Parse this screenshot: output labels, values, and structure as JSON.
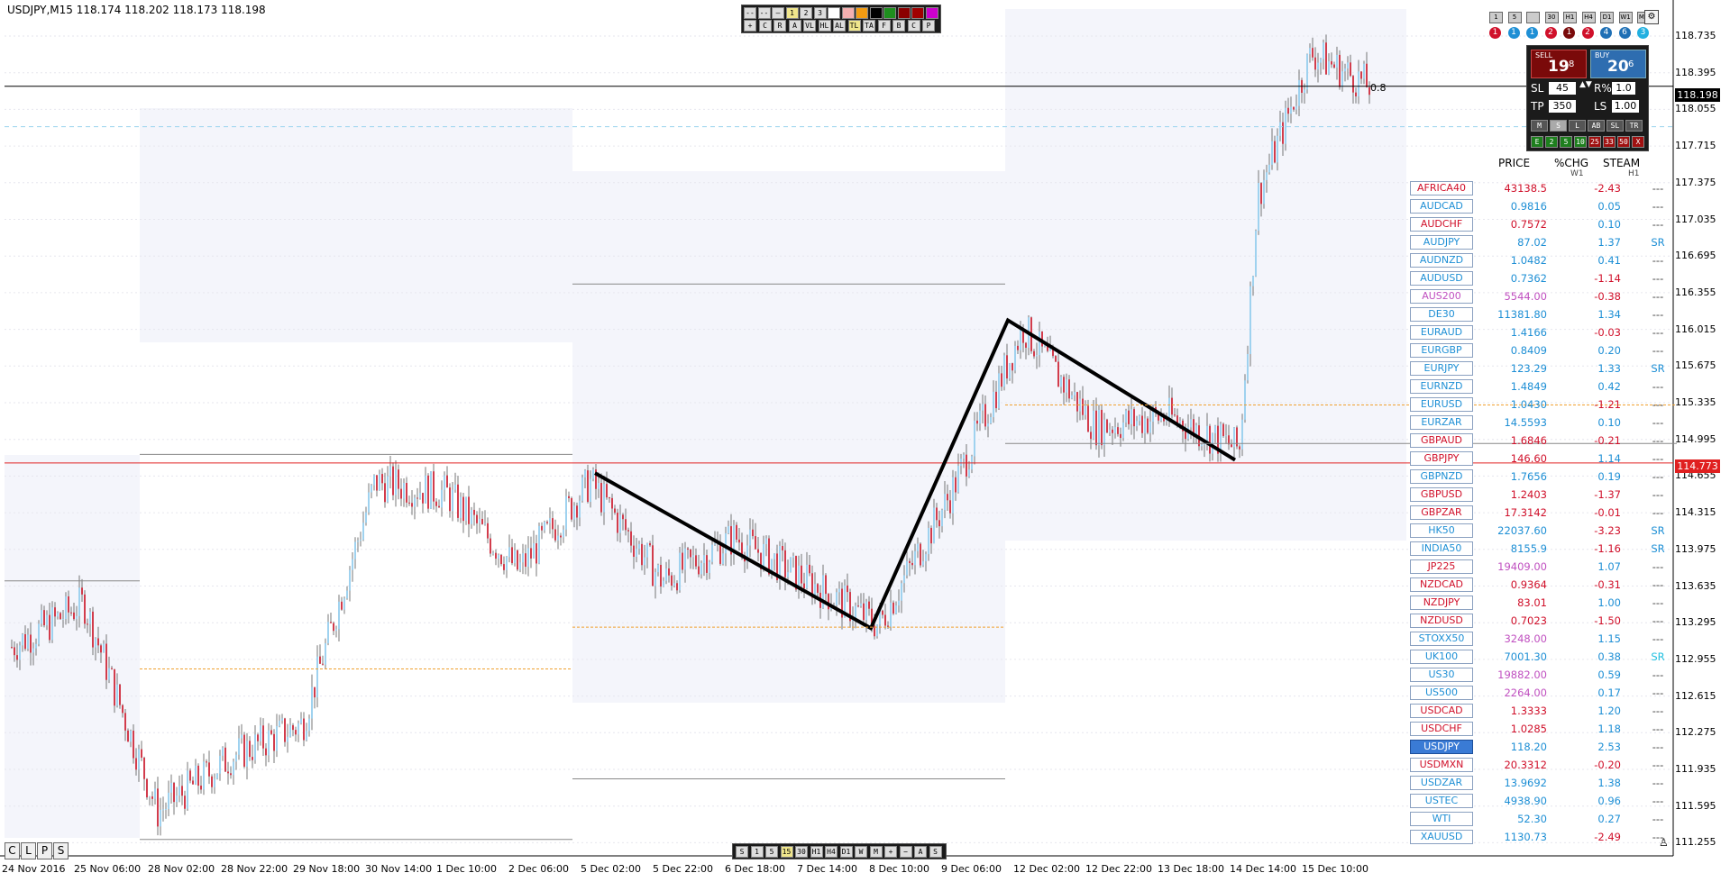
{
  "title": "USDJPY,M15  118.174 118.202 118.173 118.198",
  "current_price_label": "118.198",
  "red_line_label": "114.773",
  "fib_label": "0.8",
  "price_axis": [
    "118.735",
    "118.395",
    "118.055",
    "117.715",
    "117.375",
    "117.035",
    "116.695",
    "116.355",
    "116.015",
    "115.675",
    "115.335",
    "114.995",
    "114.655",
    "114.315",
    "113.975",
    "113.635",
    "113.295",
    "112.955",
    "112.615",
    "112.275",
    "111.935",
    "111.595",
    "111.255"
  ],
  "time_axis": [
    "24 Nov 2016",
    "25 Nov 06:00",
    "28 Nov 02:00",
    "28 Nov 22:00",
    "29 Nov 18:00",
    "30 Nov 14:00",
    "1 Dec 10:00",
    "2 Dec 06:00",
    "5 Dec 02:00",
    "5 Dec 22:00",
    "6 Dec 18:00",
    "7 Dec 14:00",
    "8 Dec 10:00",
    "9 Dec 06:00",
    "12 Dec 02:00",
    "12 Dec 22:00",
    "13 Dec 18:00",
    "14 Dec 14:00",
    "15 Dec 10:00"
  ],
  "trade_panel": {
    "sell_label": "SELL",
    "sell_big": "19",
    "sell_small": "8",
    "buy_label": "BUY",
    "buy_big": "20",
    "buy_small": "6",
    "sl_label": "SL",
    "sl_value": "45",
    "risk_label": "R%",
    "risk_value": "1.0",
    "tp_label": "TP",
    "tp_value": "350",
    "ls_label": "LS",
    "ls_value": "1.00",
    "mode_buttons": [
      "M",
      "S",
      "L",
      "AB",
      "SL",
      "TR"
    ],
    "action_buttons": [
      "E",
      "2",
      "5",
      "10",
      "25",
      "33",
      "50",
      "X"
    ]
  },
  "timeframe_buttons": [
    "1",
    "5",
    "",
    "30",
    "H1",
    "H4",
    "D1",
    "W1",
    "MN"
  ],
  "timeframe_circles": [
    {
      "label": "1",
      "color": "#d0102a"
    },
    {
      "label": "1",
      "color": "#1e8fd5"
    },
    {
      "label": "1",
      "color": "#1e8fd5"
    },
    {
      "label": "2",
      "color": "#d0102a"
    },
    {
      "label": "1",
      "color": "#7a0a0a"
    },
    {
      "label": "2",
      "color": "#d0102a"
    },
    {
      "label": "4",
      "color": "#1e6fb5"
    },
    {
      "label": "6",
      "color": "#1e6fb5"
    },
    {
      "label": "3",
      "color": "#22b0e0"
    }
  ],
  "top_toolbar": {
    "row1": [
      "--",
      "--",
      "—",
      "1",
      "2",
      "3",
      "",
      "",
      "",
      "",
      "",
      "",
      "",
      ""
    ],
    "row1_colors": [
      "#ddd",
      "#ddd",
      "#ddd",
      "#f0e68c",
      "#ddd",
      "#ddd",
      "#fff",
      "#f4b0b0",
      "#f39c12",
      "#000000",
      "#1e8f1e",
      "#8b0000",
      "#a00000",
      "#cc00cc"
    ],
    "row2": [
      "+",
      "C",
      "R",
      "A",
      "VL",
      "HL",
      "AL",
      "TL",
      "TA",
      "F",
      "B",
      "C",
      "P"
    ]
  },
  "bottom_toolbar": [
    "S",
    "1",
    "5",
    "15",
    "30",
    "H1",
    "H4",
    "D1",
    "W",
    "M",
    "+",
    "−",
    "A",
    "S"
  ],
  "clp_buttons": [
    "C",
    "L",
    "P",
    "S"
  ],
  "watchlist": {
    "headers": {
      "price": "PRICE",
      "chg": "%CHG",
      "chg_sub": "W1",
      "steam": "STEAM",
      "steam_sub": "H1"
    },
    "rows": [
      {
        "sym": "AFRICA40",
        "sym_color": "#d0102a",
        "price": "43138.5",
        "price_color": "#d0102a",
        "chg": "-2.43",
        "chg_color": "#d0102a",
        "steam": "---"
      },
      {
        "sym": "AUDCAD",
        "sym_color": "#1e8fd5",
        "price": "0.9816",
        "price_color": "#1e8fd5",
        "chg": "0.05",
        "chg_color": "#1e8fd5",
        "steam": "---"
      },
      {
        "sym": "AUDCHF",
        "sym_color": "#d0102a",
        "price": "0.7572",
        "price_color": "#d0102a",
        "chg": "0.10",
        "chg_color": "#1e8fd5",
        "steam": "---"
      },
      {
        "sym": "AUDJPY",
        "sym_color": "#1e8fd5",
        "price": "87.02",
        "price_color": "#1e8fd5",
        "chg": "1.37",
        "chg_color": "#1e8fd5",
        "steam": "SR"
      },
      {
        "sym": "AUDNZD",
        "sym_color": "#1e8fd5",
        "price": "1.0482",
        "price_color": "#1e8fd5",
        "chg": "0.41",
        "chg_color": "#1e8fd5",
        "steam": "---"
      },
      {
        "sym": "AUDUSD",
        "sym_color": "#1e8fd5",
        "price": "0.7362",
        "price_color": "#1e8fd5",
        "chg": "-1.14",
        "chg_color": "#d0102a",
        "steam": "---"
      },
      {
        "sym": "AUS200",
        "sym_color": "#c050c0",
        "price": "5544.00",
        "price_color": "#c050c0",
        "chg": "-0.38",
        "chg_color": "#d0102a",
        "steam": "---"
      },
      {
        "sym": "DE30",
        "sym_color": "#1e8fd5",
        "price": "11381.80",
        "price_color": "#1e8fd5",
        "chg": "1.34",
        "chg_color": "#1e8fd5",
        "steam": "---"
      },
      {
        "sym": "EURAUD",
        "sym_color": "#1e8fd5",
        "price": "1.4166",
        "price_color": "#1e8fd5",
        "chg": "-0.03",
        "chg_color": "#d0102a",
        "steam": "---"
      },
      {
        "sym": "EURGBP",
        "sym_color": "#1e8fd5",
        "price": "0.8409",
        "price_color": "#1e8fd5",
        "chg": "0.20",
        "chg_color": "#1e8fd5",
        "steam": "---"
      },
      {
        "sym": "EURJPY",
        "sym_color": "#1e8fd5",
        "price": "123.29",
        "price_color": "#1e8fd5",
        "chg": "1.33",
        "chg_color": "#1e8fd5",
        "steam": "SR"
      },
      {
        "sym": "EURNZD",
        "sym_color": "#1e8fd5",
        "price": "1.4849",
        "price_color": "#1e8fd5",
        "chg": "0.42",
        "chg_color": "#1e8fd5",
        "steam": "---"
      },
      {
        "sym": "EURUSD",
        "sym_color": "#1e8fd5",
        "price": "1.0430",
        "price_color": "#1e8fd5",
        "chg": "-1.21",
        "chg_color": "#d0102a",
        "steam": "---"
      },
      {
        "sym": "EURZAR",
        "sym_color": "#1e8fd5",
        "price": "14.5593",
        "price_color": "#1e8fd5",
        "chg": "0.10",
        "chg_color": "#1e8fd5",
        "steam": "---"
      },
      {
        "sym": "GBPAUD",
        "sym_color": "#d0102a",
        "price": "1.6846",
        "price_color": "#d0102a",
        "chg": "-0.21",
        "chg_color": "#d0102a",
        "steam": "---"
      },
      {
        "sym": "GBPJPY",
        "sym_color": "#d0102a",
        "price": "146.60",
        "price_color": "#d0102a",
        "chg": "1.14",
        "chg_color": "#1e8fd5",
        "steam": "---"
      },
      {
        "sym": "GBPNZD",
        "sym_color": "#1e8fd5",
        "price": "1.7656",
        "price_color": "#1e8fd5",
        "chg": "0.19",
        "chg_color": "#1e8fd5",
        "steam": "---"
      },
      {
        "sym": "GBPUSD",
        "sym_color": "#d0102a",
        "price": "1.2403",
        "price_color": "#d0102a",
        "chg": "-1.37",
        "chg_color": "#d0102a",
        "steam": "---"
      },
      {
        "sym": "GBPZAR",
        "sym_color": "#d0102a",
        "price": "17.3142",
        "price_color": "#d0102a",
        "chg": "-0.01",
        "chg_color": "#d0102a",
        "steam": "---"
      },
      {
        "sym": "HK50",
        "sym_color": "#1e8fd5",
        "price": "22037.60",
        "price_color": "#1e8fd5",
        "chg": "-3.23",
        "chg_color": "#d0102a",
        "steam": "SR"
      },
      {
        "sym": "INDIA50",
        "sym_color": "#1e8fd5",
        "price": "8155.9",
        "price_color": "#1e8fd5",
        "chg": "-1.16",
        "chg_color": "#d0102a",
        "steam": "SR"
      },
      {
        "sym": "JP225",
        "sym_color": "#d0102a",
        "price": "19409.00",
        "price_color": "#c050c0",
        "chg": "1.07",
        "chg_color": "#1e8fd5",
        "steam": "---"
      },
      {
        "sym": "NZDCAD",
        "sym_color": "#d0102a",
        "price": "0.9364",
        "price_color": "#d0102a",
        "chg": "-0.31",
        "chg_color": "#d0102a",
        "steam": "---"
      },
      {
        "sym": "NZDJPY",
        "sym_color": "#d0102a",
        "price": "83.01",
        "price_color": "#d0102a",
        "chg": "1.00",
        "chg_color": "#1e8fd5",
        "steam": "---"
      },
      {
        "sym": "NZDUSD",
        "sym_color": "#d0102a",
        "price": "0.7023",
        "price_color": "#d0102a",
        "chg": "-1.50",
        "chg_color": "#d0102a",
        "steam": "---"
      },
      {
        "sym": "STOXX50",
        "sym_color": "#1e8fd5",
        "price": "3248.00",
        "price_color": "#c050c0",
        "chg": "1.15",
        "chg_color": "#1e8fd5",
        "steam": "---"
      },
      {
        "sym": "UK100",
        "sym_color": "#1e8fd5",
        "price": "7001.30",
        "price_color": "#1e8fd5",
        "chg": "0.38",
        "chg_color": "#1e8fd5",
        "steam": "SR",
        "steam_color": "#22c0e0"
      },
      {
        "sym": "US30",
        "sym_color": "#1e8fd5",
        "price": "19882.00",
        "price_color": "#c050c0",
        "chg": "0.59",
        "chg_color": "#1e8fd5",
        "steam": "---"
      },
      {
        "sym": "US500",
        "sym_color": "#1e8fd5",
        "price": "2264.00",
        "price_color": "#c050c0",
        "chg": "0.17",
        "chg_color": "#1e8fd5",
        "steam": "---"
      },
      {
        "sym": "USDCAD",
        "sym_color": "#d0102a",
        "price": "1.3333",
        "price_color": "#d0102a",
        "chg": "1.20",
        "chg_color": "#1e8fd5",
        "steam": "---"
      },
      {
        "sym": "USDCHF",
        "sym_color": "#d0102a",
        "price": "1.0285",
        "price_color": "#d0102a",
        "chg": "1.18",
        "chg_color": "#1e8fd5",
        "steam": "---"
      },
      {
        "sym": "USDJPY",
        "sym_color": "#ffffff",
        "selected": true,
        "price": "118.20",
        "price_color": "#1e8fd5",
        "chg": "2.53",
        "chg_color": "#1e8fd5",
        "steam": "---"
      },
      {
        "sym": "USDMXN",
        "sym_color": "#d0102a",
        "price": "20.3312",
        "price_color": "#d0102a",
        "chg": "-0.20",
        "chg_color": "#d0102a",
        "steam": "---"
      },
      {
        "sym": "USDZAR",
        "sym_color": "#1e8fd5",
        "price": "13.9692",
        "price_color": "#1e8fd5",
        "chg": "1.38",
        "chg_color": "#1e8fd5",
        "steam": "---"
      },
      {
        "sym": "USTEC",
        "sym_color": "#1e8fd5",
        "price": "4938.90",
        "price_color": "#1e8fd5",
        "chg": "0.96",
        "chg_color": "#1e8fd5",
        "steam": "---"
      },
      {
        "sym": "WTI",
        "sym_color": "#1e8fd5",
        "price": "52.30",
        "price_color": "#1e8fd5",
        "chg": "0.27",
        "chg_color": "#1e8fd5",
        "steam": "---"
      },
      {
        "sym": "XAUUSD",
        "sym_color": "#1e8fd5",
        "price": "1130.73",
        "price_color": "#1e8fd5",
        "chg": "-2.49",
        "chg_color": "#d0102a",
        "steam": "---"
      }
    ]
  },
  "chart_data": {
    "type": "candlestick",
    "ylim": [
      111.2,
      118.9
    ],
    "zigzag": [
      {
        "time": "5 Dec 02:00",
        "price": 114.68
      },
      {
        "time": "8 Dec 10:00",
        "price": 113.27
      },
      {
        "time": "12 Dec 02:00",
        "price": 116.07
      },
      {
        "time": "14 Dec 14:00",
        "price": 114.8
      }
    ],
    "path": [
      [
        "24 Nov 2016",
        113.1
      ],
      [
        "25 Nov 06:00",
        113.5
      ],
      [
        "28 Nov 02:00",
        111.6
      ],
      [
        "28 Nov 22:00",
        112.1
      ],
      [
        "29 Nov 18:00",
        112.4
      ],
      [
        "30 Nov 14:00",
        114.6
      ],
      [
        "1 Dec 10:00",
        114.5
      ],
      [
        "2 Dec 06:00",
        113.8
      ],
      [
        "5 Dec 02:00",
        114.6
      ],
      [
        "5 Dec 22:00",
        113.7
      ],
      [
        "6 Dec 18:00",
        114.1
      ],
      [
        "7 Dec 14:00",
        113.7
      ],
      [
        "8 Dec 10:00",
        113.3
      ],
      [
        "9 Dec 06:00",
        114.5
      ],
      [
        "12 Dec 02:00",
        116.0
      ],
      [
        "12 Dec 22:00",
        115.1
      ],
      [
        "13 Dec 18:00",
        115.2
      ],
      [
        "14 Dec 14:00",
        114.9
      ],
      [
        "14 Dec 20:00",
        117.2
      ],
      [
        "15 Dec 10:00",
        118.5
      ],
      [
        "15 Dec 18:00",
        118.2
      ]
    ],
    "levels": [
      {
        "price": 118.198,
        "color": "#000000"
      },
      {
        "price": 114.773,
        "color": "#e02020"
      }
    ]
  }
}
